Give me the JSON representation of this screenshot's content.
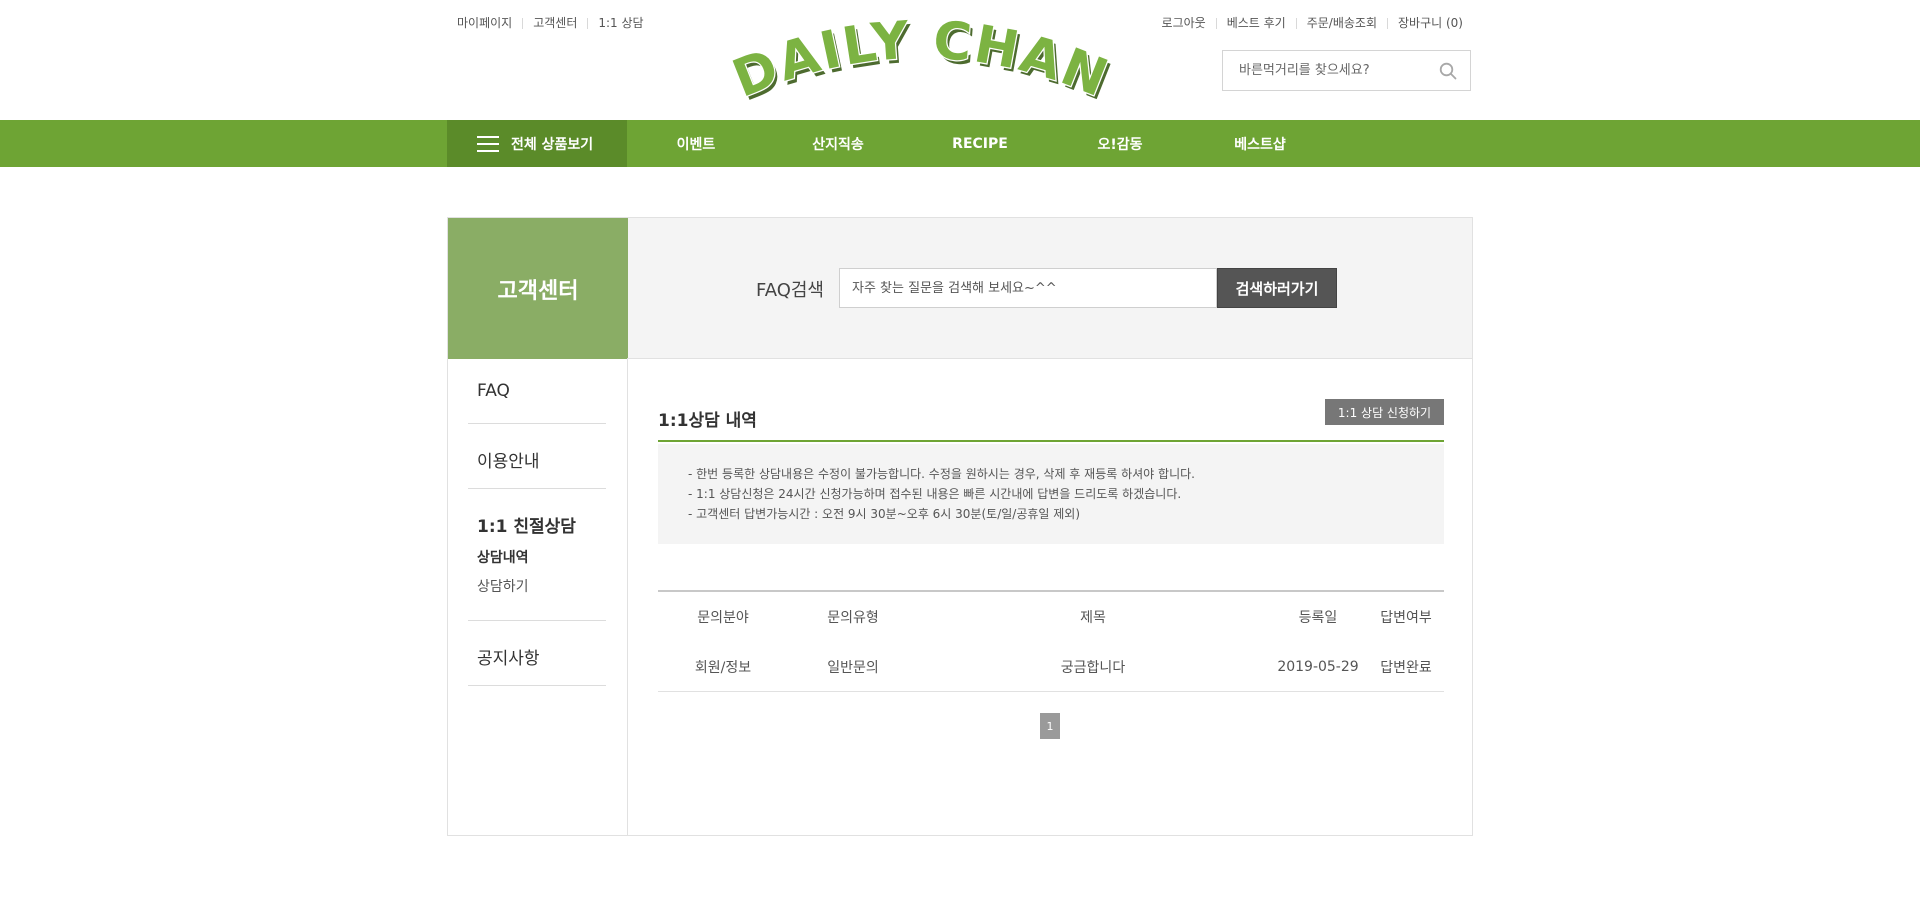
{
  "top_links_left": [
    "마이페이지",
    "고객센터",
    "1:1 상담"
  ],
  "top_links_right": [
    "로그아웃",
    "베스트 후기",
    "주문/배송조회",
    "장바구니 (0)"
  ],
  "logo": {
    "text": "DAILY CHAN",
    "fill_color": "#6ea434",
    "outline_color": "#4d6b2f"
  },
  "search": {
    "placeholder": "바른먹거리를 찾으세요?"
  },
  "nav": {
    "all_products": "전체 상품보기",
    "items": [
      "이벤트",
      "산지직송",
      "RECIPE",
      "오!감동",
      "베스트샵"
    ],
    "bg_color": "#6ea434",
    "active_bg_color": "#5b8b29"
  },
  "sidebar": {
    "title": "고객센터",
    "menu": [
      {
        "label": "FAQ",
        "children": []
      },
      {
        "label": "이용안내",
        "children": []
      },
      {
        "label": "1:1 친절상담",
        "active": true,
        "children": [
          "상담내역",
          "상담하기"
        ]
      },
      {
        "label": "공지사항",
        "children": []
      }
    ]
  },
  "faq_search": {
    "label": "FAQ검색",
    "placeholder": "자주 찾는 질문을 검색해 보세요~^^",
    "button": "검색하러가기"
  },
  "section": {
    "title": "1:1상담 내역",
    "apply_button": "1:1 상담 신청하기",
    "notices": [
      "- 한번 등록한 상담내용은 수정이 불가능합니다. 수정을 원하시는 경우, 삭제 후 재등록 하셔야 합니다.",
      "- 1:1 상담신청은 24시간 신청가능하며 접수된 내용은 빠른 시간내에 답변을 드리도록 하겠습니다.",
      "- 고객센터 답변가능시간 : 오전 9시 30분~오후 6시 30분(토/일/공휴일 제외)"
    ]
  },
  "table": {
    "headers": [
      "문의분야",
      "문의유형",
      "제목",
      "등록일",
      "답변여부"
    ],
    "rows": [
      [
        "회원/정보",
        "일반문의",
        "궁금합니다",
        "2019-05-29",
        "답변완료"
      ]
    ]
  },
  "pagination": {
    "current": "1"
  }
}
